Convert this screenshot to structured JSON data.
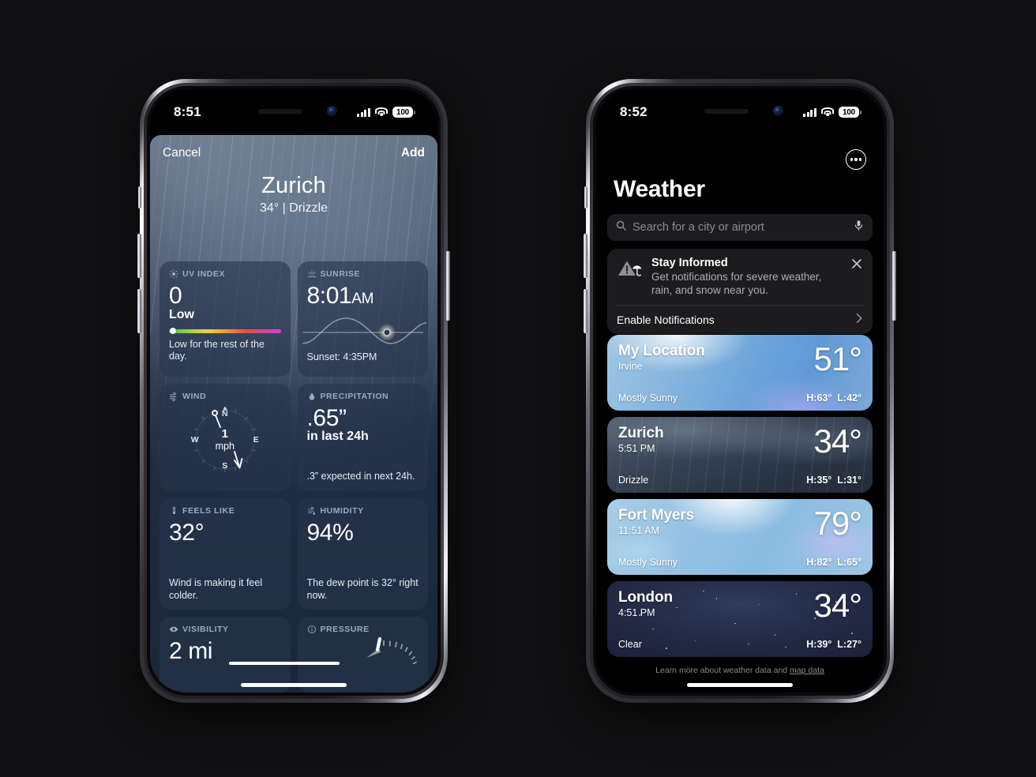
{
  "page": {
    "background": "#111113"
  },
  "phone_left": {
    "status": {
      "time": "8:51",
      "battery": "100",
      "signal_icon": "cellular-bars-icon",
      "wifi_icon": "wifi-icon",
      "battery_icon": "battery-icon"
    },
    "sheet": {
      "cancel_label": "Cancel",
      "add_label": "Add",
      "city": "Zurich",
      "summary": "34° | Drizzle",
      "cards": {
        "uv": {
          "title": "UV INDEX",
          "icon": "sun-icon",
          "value": "0",
          "level": "Low",
          "footer": "Low for the rest of the day.",
          "gradient": [
            "#3cc14b",
            "#8fd438",
            "#f2d430",
            "#f59a26",
            "#ea4f3d",
            "#d9409a",
            "#c64ad4"
          ],
          "marker_percent": 0
        },
        "sunrise": {
          "title": "SUNRISE",
          "icon": "sunrise-icon",
          "time": "8:01",
          "meridiem": "AM",
          "footer": "Sunset: 4:35PM",
          "sun_position_percent": 72
        },
        "wind": {
          "title": "WIND",
          "icon": "wind-icon",
          "speed": "1",
          "unit": "mph",
          "labels": {
            "n": "N",
            "s": "S",
            "e": "E",
            "w": "W"
          },
          "direction_degrees": 190
        },
        "precipitation": {
          "title": "PRECIPITATION",
          "icon": "droplet-icon",
          "value": ".65”",
          "period": "in last 24h",
          "footer": ".3” expected in next 24h."
        },
        "feels_like": {
          "title": "FEELS LIKE",
          "icon": "thermometer-icon",
          "value": "32°",
          "footer": "Wind is making it feel colder."
        },
        "humidity": {
          "title": "HUMIDITY",
          "icon": "humidity-icon",
          "value": "94%",
          "footer": "The dew point is 32° right now."
        },
        "visibility": {
          "title": "VISIBILITY",
          "icon": "eye-icon",
          "value": "2 mi"
        },
        "pressure": {
          "title": "PRESSURE",
          "icon": "info-circle-icon"
        }
      }
    }
  },
  "phone_right": {
    "status": {
      "time": "8:52",
      "battery": "100",
      "signal_icon": "cellular-bars-icon",
      "wifi_icon": "wifi-icon",
      "battery_icon": "battery-icon"
    },
    "header": {
      "title": "Weather",
      "menu_icon": "ellipsis-circle-icon"
    },
    "search": {
      "placeholder": "Search for a city or airport",
      "icon": "search-icon",
      "mic_icon": "microphone-icon"
    },
    "notice": {
      "icon": "severe-weather-alert-icon",
      "title": "Stay Informed",
      "body": "Get notifications for severe weather, rain, and snow near you.",
      "cta_label": "Enable Notifications",
      "chevron_icon": "chevron-right-icon",
      "close_icon": "close-icon"
    },
    "cities": [
      {
        "name": "My Location",
        "sub": "Irvine",
        "condition": "Mostly Sunny",
        "temp": "51°",
        "high": "H:63°",
        "low": "L:42°",
        "theme": "sunny"
      },
      {
        "name": "Zurich",
        "sub": "5:51 PM",
        "condition": "Drizzle",
        "temp": "34°",
        "high": "H:35°",
        "low": "L:31°",
        "theme": "drizzle"
      },
      {
        "name": "Fort Myers",
        "sub": "11:51 AM",
        "condition": "Mostly Sunny",
        "temp": "79°",
        "high": "H:82°",
        "low": "L:65°",
        "theme": "bright"
      },
      {
        "name": "London",
        "sub": "4:51 PM",
        "condition": "Clear",
        "temp": "34°",
        "high": "H:39°",
        "low": "L:27°",
        "theme": "night"
      }
    ],
    "footer": {
      "prefix": "Learn more about weather data and ",
      "link": "map data"
    }
  }
}
